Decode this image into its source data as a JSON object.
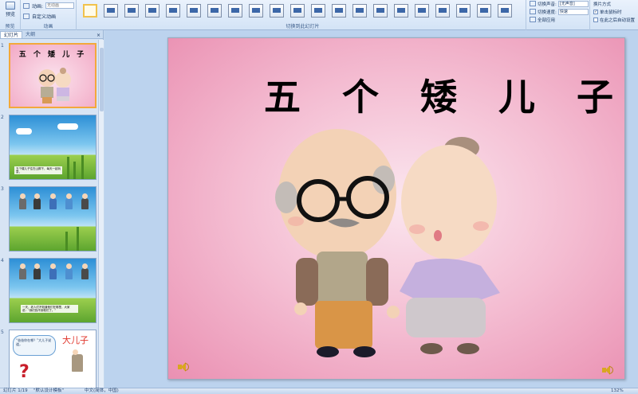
{
  "ribbon": {
    "preview_label": "预览",
    "preview_group": "预览",
    "anim_label": "动画:",
    "anim_value": "无动画",
    "custom_anim_label": "自定义动画",
    "anim_group": "动画",
    "transition_group": "切换到此幻灯片",
    "sound_label": "切换声音:",
    "sound_value": "[无声音]",
    "speed_label": "切换速度:",
    "speed_value": "快速",
    "apply_all_label": "全部应用",
    "advance_label": "换片方式",
    "on_click_label": "单击鼠标时",
    "auto_label": "在此之后自动设置"
  },
  "panel": {
    "tab_slides": "幻灯片",
    "tab_outline": "大纲",
    "close": "×",
    "slide1_title": "五 个 矮 儿 子",
    "slide2_text": "五个矮儿子住在山脚下，每天一起玩耍，",
    "slide4_text": "一天，老人们不知道他们在哪里，大家说：“我们找不到他们了。”",
    "slide5_bubble": "“爸爸你在哪？”大儿子说道，",
    "slide5_title": "大儿子",
    "slide5_mark": "?",
    "numbers": [
      "1",
      "2",
      "3",
      "4",
      "5"
    ]
  },
  "slide": {
    "title": "五 个 矮 儿 子"
  },
  "status": {
    "slide_count": "幻灯片 1/19",
    "theme": "\"默认设计模板\"",
    "language": "中文(简体，中国)",
    "zoom": "132%"
  }
}
